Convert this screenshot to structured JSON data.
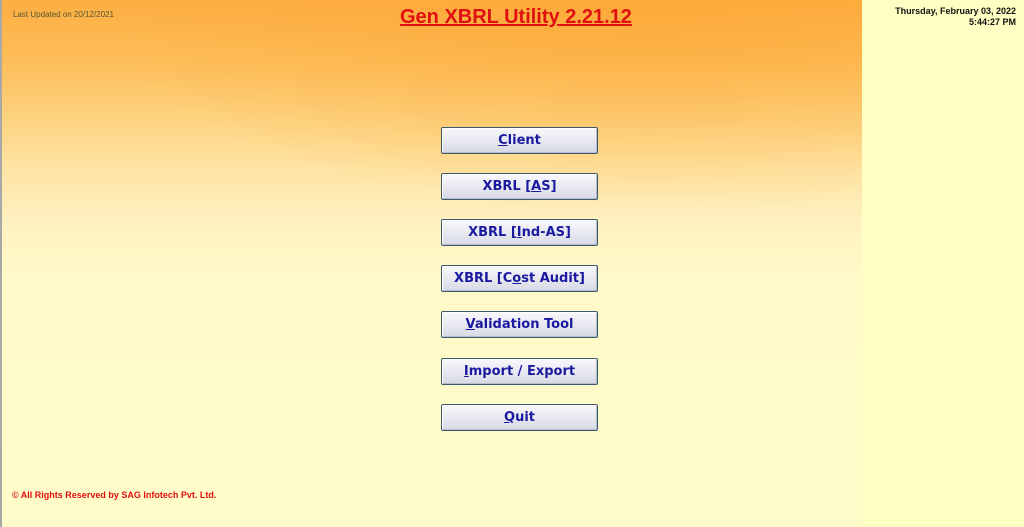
{
  "header": {
    "last_updated": "Last Updated on 20/12/2021",
    "title": "Gen XBRL Utility 2.21.12",
    "date": "Thursday, February 03, 2022",
    "time": "5:44:27 PM"
  },
  "menu": {
    "client": {
      "pre": "",
      "key": "C",
      "post": "lient"
    },
    "xbrl_as": {
      "pre": "XBRL [",
      "key": "A",
      "post": "S]"
    },
    "xbrl_ind_as": {
      "pre": "XBRL [",
      "key": "I",
      "post": "nd-AS]"
    },
    "xbrl_cost_audit": {
      "pre": "XBRL [C",
      "key": "o",
      "post": "st Audit]"
    },
    "validation_tool": {
      "pre": "",
      "key": "V",
      "post": "alidation Tool"
    },
    "import_export": {
      "pre": "",
      "key": "I",
      "post": "mport / Export"
    },
    "quit": {
      "pre": "",
      "key": "Q",
      "post": "uit"
    }
  },
  "footer": {
    "copyright": "© All Rights Reserved by SAG Infotech Pvt. Ltd."
  },
  "colors": {
    "title_red": "#e01010",
    "button_text": "#1a1aa0",
    "gradient_top": "#fdae42",
    "background": "#fffcca"
  }
}
